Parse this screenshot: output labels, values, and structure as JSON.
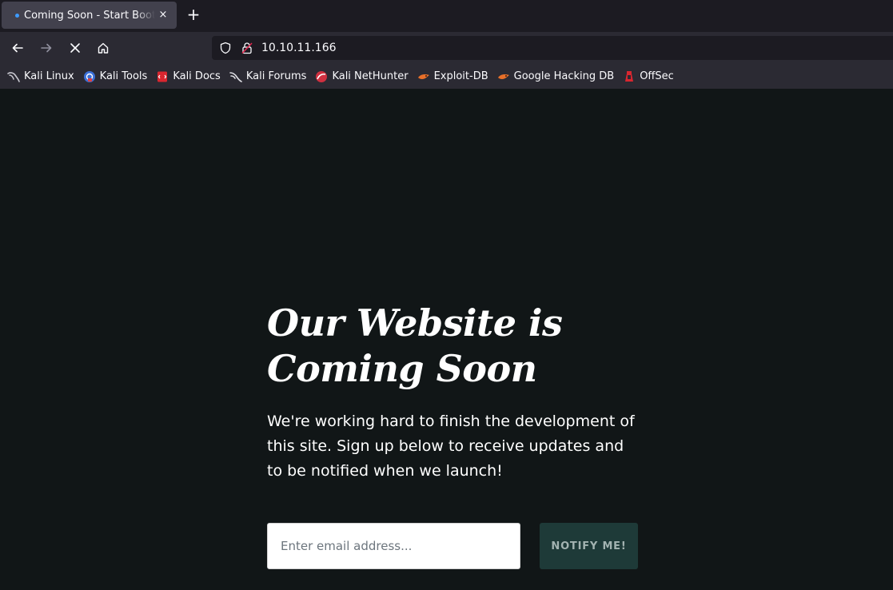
{
  "browser": {
    "tab": {
      "title": "Coming Soon - Start Bootstrap",
      "close_glyph": "×"
    },
    "new_tab_glyph": "+",
    "url": "10.10.11.166",
    "bookmarks": [
      {
        "label": "Kali Linux",
        "icon": "kali-dragon-icon"
      },
      {
        "label": "Kali Tools",
        "icon": "kali-tools-icon"
      },
      {
        "label": "Kali Docs",
        "icon": "kali-docs-icon"
      },
      {
        "label": "Kali Forums",
        "icon": "kali-forums-icon"
      },
      {
        "label": "Kali NetHunter",
        "icon": "nethunter-icon"
      },
      {
        "label": "Exploit-DB",
        "icon": "exploit-db-icon"
      },
      {
        "label": "Google Hacking DB",
        "icon": "ghdb-icon"
      },
      {
        "label": "OffSec",
        "icon": "offsec-icon"
      }
    ]
  },
  "page": {
    "headline": "Our Website is Coming Soon",
    "subtext": "We're working hard to finish the development of this site. Sign up below to receive updates and to be notified when we launch!",
    "email_placeholder": "Enter email address...",
    "email_value": "",
    "notify_label": "NOTIFY ME!"
  },
  "colors": {
    "page_bg": "#111617",
    "button_bg": "#1e3a38",
    "loading_dot": "#3d9bff"
  }
}
